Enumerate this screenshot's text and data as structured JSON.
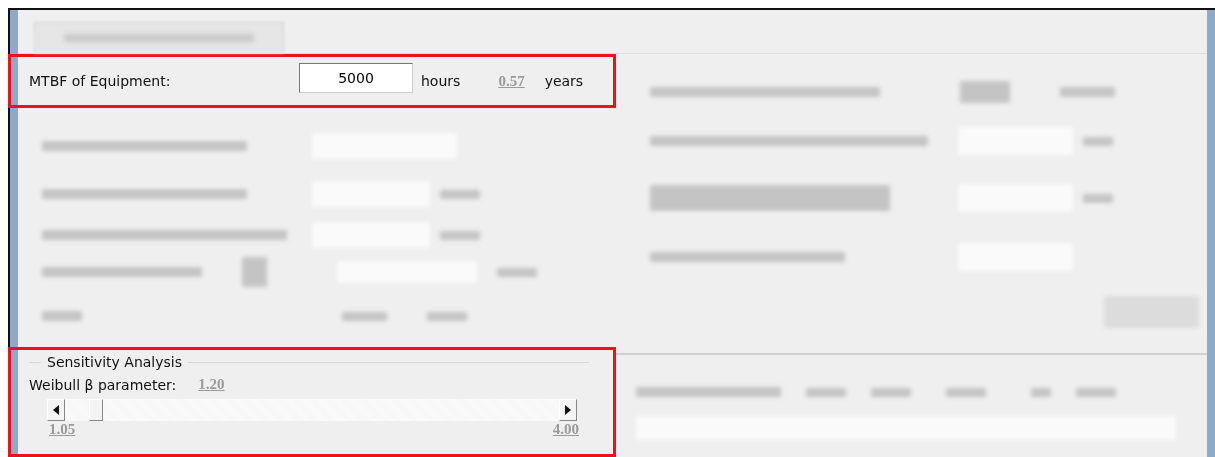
{
  "mtbf": {
    "highlighted": true,
    "label": "MTBF of Equipment:",
    "value": "5000",
    "unit": "hours",
    "years_value": "0.57",
    "years_unit": "years"
  },
  "sensitivity": {
    "highlighted": true,
    "title": "Sensitivity Analysis",
    "parameter_label": "Weibull β parameter:",
    "parameter_value": "1.20",
    "slider": {
      "level": 0.05,
      "min_label": "1.05",
      "max_label": "4.00"
    }
  }
}
